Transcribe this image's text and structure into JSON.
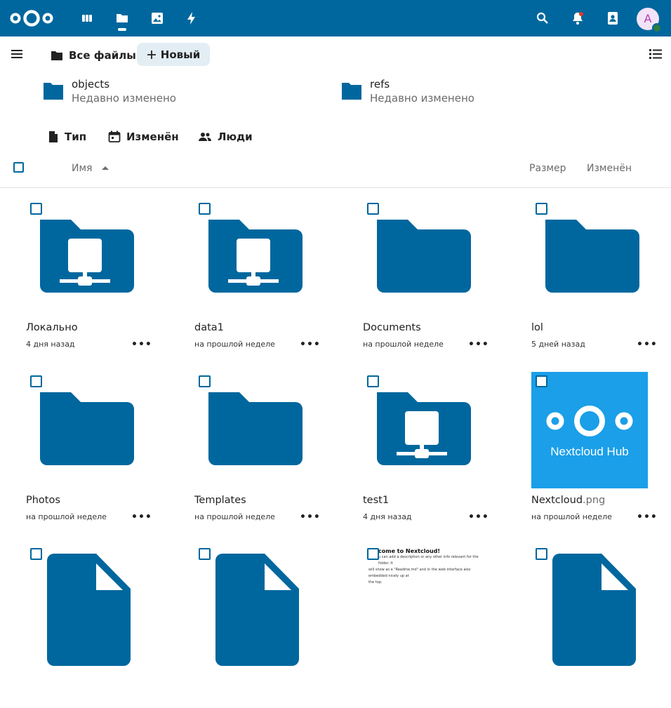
{
  "colors": {
    "header": "#00679e",
    "folder": "#00679e",
    "accent": "#00679e"
  },
  "header": {
    "apps": [
      "dashboard-icon",
      "files-icon",
      "photos-icon",
      "activity-icon"
    ],
    "right_icons": [
      "search-icon",
      "notifications-icon",
      "contacts-icon"
    ],
    "avatar_letter": "A"
  },
  "toolbar": {
    "breadcrumb": "Все файлы",
    "new_label": "Новый"
  },
  "recent": [
    {
      "name": "objects",
      "sub": "Недавно изменено"
    },
    {
      "name": "refs",
      "sub": "Недавно изменено"
    }
  ],
  "filters": [
    {
      "label": "Тип",
      "icon": "file-type-icon"
    },
    {
      "label": "Изменён",
      "icon": "calendar-icon"
    },
    {
      "label": "Люди",
      "icon": "people-icon"
    }
  ],
  "columns": {
    "name": "Имя",
    "size": "Размер",
    "modified": "Изменён"
  },
  "files": [
    {
      "name": "Локально",
      "ext": "",
      "modified": "4 дня назад",
      "kind": "external-folder"
    },
    {
      "name": "data1",
      "ext": "",
      "modified": "на прошлой неделе",
      "kind": "external-folder"
    },
    {
      "name": "Documents",
      "ext": "",
      "modified": "на прошлой неделе",
      "kind": "folder"
    },
    {
      "name": "lol",
      "ext": "",
      "modified": "5 дней назад",
      "kind": "folder"
    },
    {
      "name": "Photos",
      "ext": "",
      "modified": "на прошлой неделе",
      "kind": "folder"
    },
    {
      "name": "Templates",
      "ext": "",
      "modified": "на прошлой неделе",
      "kind": "folder"
    },
    {
      "name": "test1",
      "ext": "",
      "modified": "4 дня назад",
      "kind": "external-folder"
    },
    {
      "name": "Nextcloud",
      "ext": ".png",
      "modified": "на прошлой неделе",
      "kind": "image"
    },
    {
      "name": "",
      "ext": "",
      "modified": "",
      "kind": "file"
    },
    {
      "name": "",
      "ext": "",
      "modified": "",
      "kind": "file"
    },
    {
      "name": "",
      "ext": "",
      "modified": "",
      "kind": "document"
    },
    {
      "name": "",
      "ext": "",
      "modified": "",
      "kind": "file"
    }
  ],
  "thumbnail_text": "Nextcloud Hub",
  "readme_preview": {
    "title": "come to Nextcloud!",
    "line1": "u can add a description or any other info relevant for the folder. It",
    "line2": "will show as a \"Readme.md\" and in the web interface also embedded nicely up at",
    "line3": "the top."
  },
  "more_label": "•••"
}
